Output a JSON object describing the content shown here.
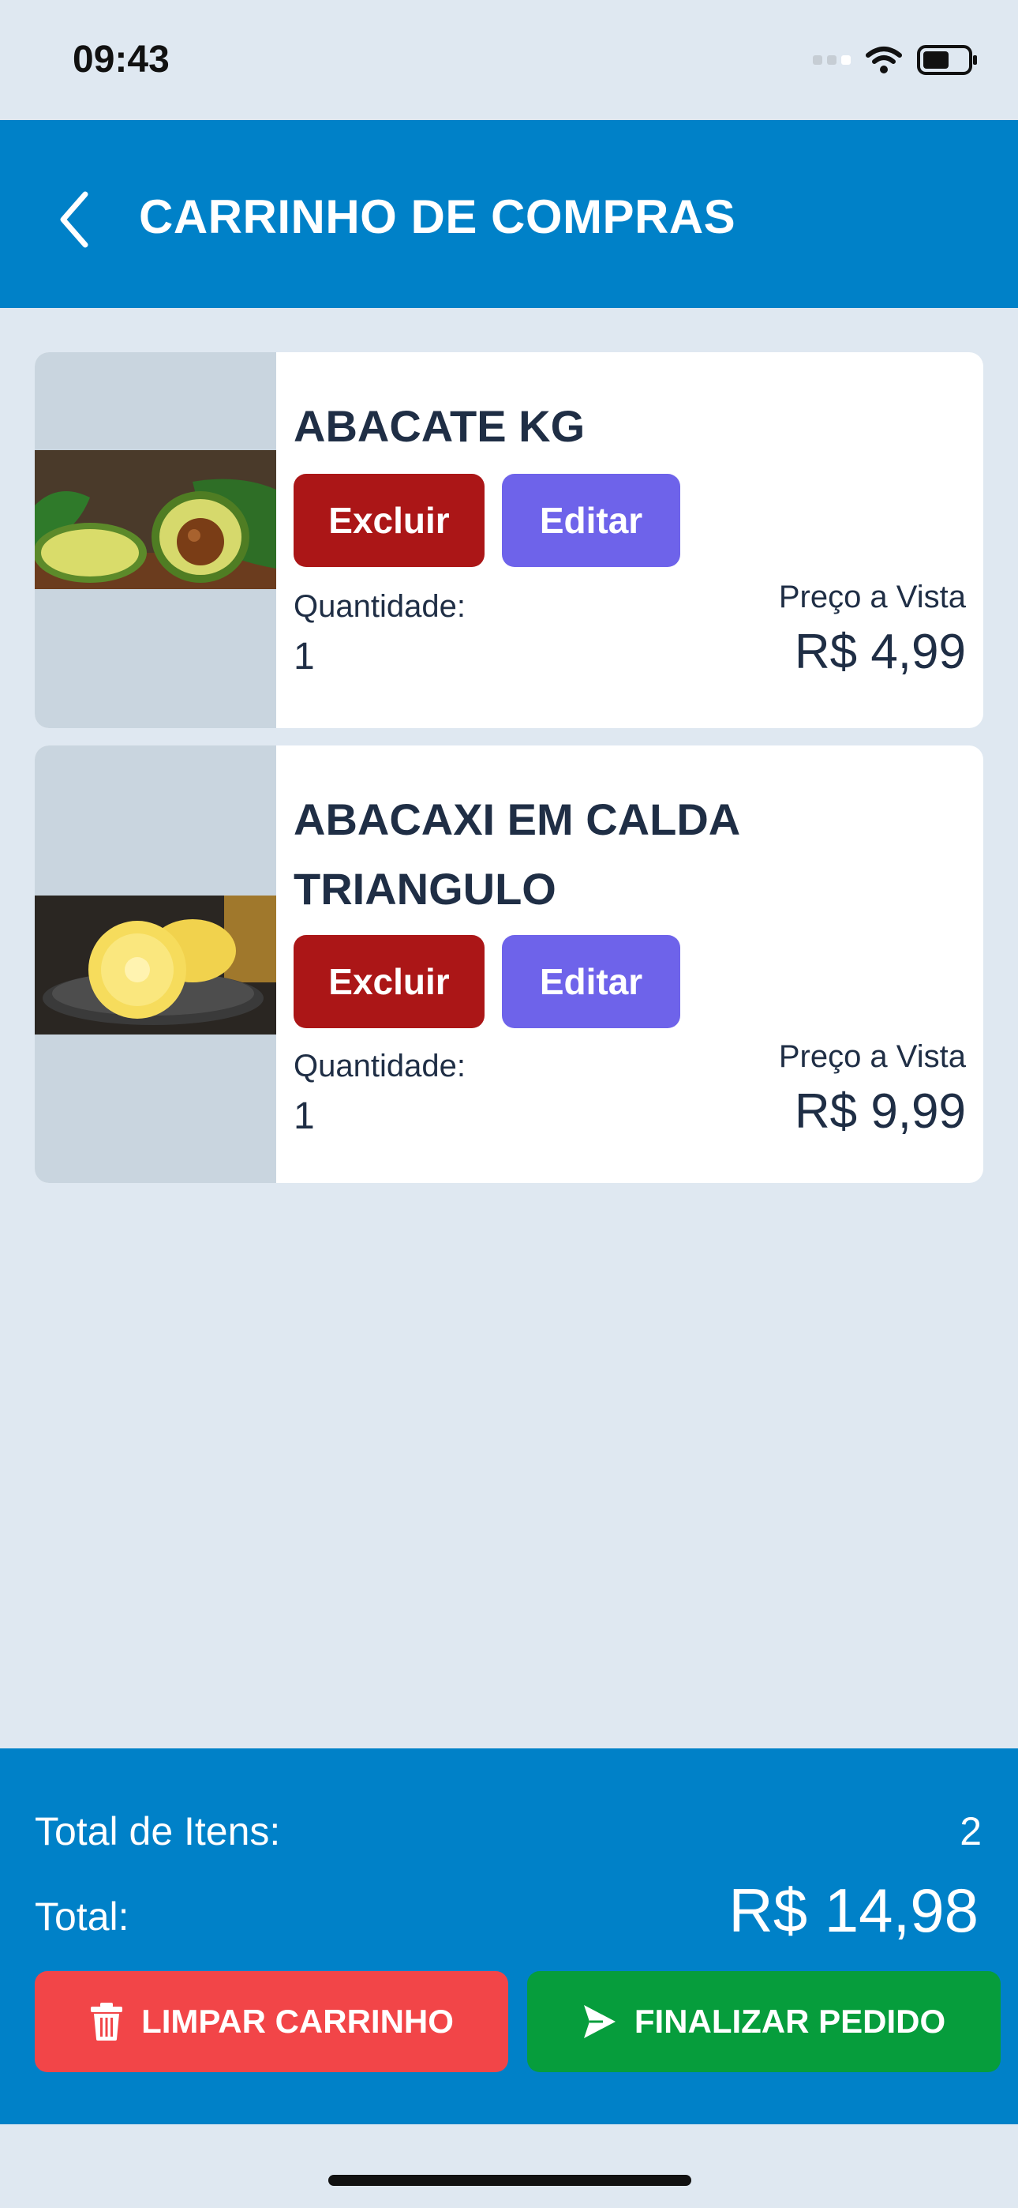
{
  "status_bar": {
    "time": "09:43"
  },
  "header": {
    "title": "CARRINHO DE COMPRAS",
    "back_icon": "chevron-left-icon"
  },
  "cart_items": [
    {
      "name": "ABACATE KG",
      "delete_label": "Excluir",
      "edit_label": "Editar",
      "quantity_label": "Quantidade:",
      "quantity": "1",
      "price_label": "Preço a Vista",
      "price": "R$ 4,99"
    },
    {
      "name": "ABACAXI EM CALDA TRIANGULO",
      "delete_label": "Excluir",
      "edit_label": "Editar",
      "quantity_label": "Quantidade:",
      "quantity": "1",
      "price_label": "Preço a Vista",
      "price": "R$ 9,99"
    }
  ],
  "footer": {
    "total_items_label": "Total de Itens:",
    "total_items": "2",
    "total_label": "Total:",
    "total": "R$ 14,98",
    "clear_label": "LIMPAR CARRINHO",
    "clear_icon": "trash-icon",
    "finish_label": "FINALIZAR PEDIDO",
    "finish_icon": "send-icon"
  },
  "colors": {
    "header": "#0081c8",
    "background": "#dfe8f1",
    "delete": "#ab1617",
    "edit": "#6e63ea",
    "clear": "#f24548",
    "finish": "#069d3c"
  }
}
